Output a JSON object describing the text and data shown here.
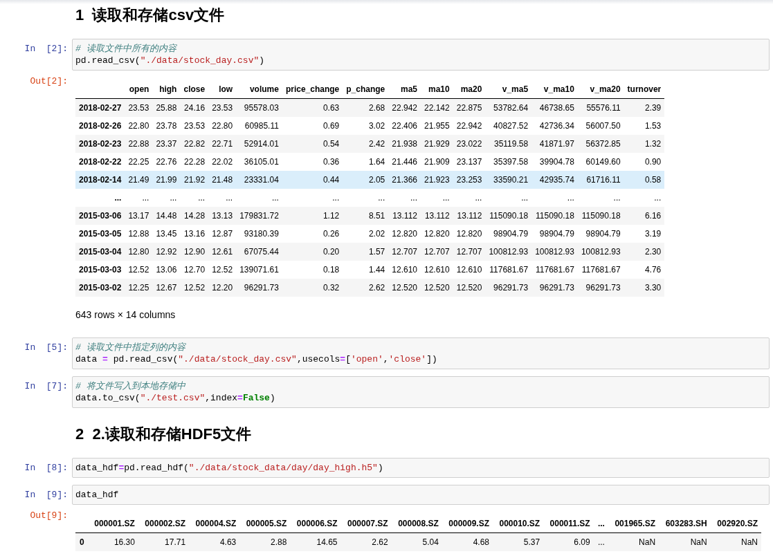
{
  "cells": [
    {
      "kind": "heading",
      "text": "1  读取和存储csv文件"
    },
    {
      "kind": "code",
      "prompt": "In  [2]:",
      "lines": [
        [
          {
            "kind": "comment",
            "text": "# 读取文件中所有的内容"
          }
        ],
        [
          {
            "kind": "plain",
            "text": "pd.read_csv("
          },
          {
            "kind": "string",
            "text": "\"./data/stock_day.csv\""
          },
          {
            "kind": "plain",
            "text": ")"
          }
        ]
      ]
    },
    {
      "kind": "output",
      "prompt": "Out[2]:",
      "table": {
        "columns": [
          "",
          "open",
          "high",
          "close",
          "low",
          "volume",
          "price_change",
          "p_change",
          "ma5",
          "ma10",
          "ma20",
          "v_ma5",
          "v_ma10",
          "v_ma20",
          "turnover"
        ],
        "rows": [
          {
            "selected": false,
            "cells": [
              "2018-02-27",
              "23.53",
              "25.88",
              "24.16",
              "23.53",
              "95578.03",
              "0.63",
              "2.68",
              "22.942",
              "22.142",
              "22.875",
              "53782.64",
              "46738.65",
              "55576.11",
              "2.39"
            ]
          },
          {
            "selected": false,
            "cells": [
              "2018-02-26",
              "22.80",
              "23.78",
              "23.53",
              "22.80",
              "60985.11",
              "0.69",
              "3.02",
              "22.406",
              "21.955",
              "22.942",
              "40827.52",
              "42736.34",
              "56007.50",
              "1.53"
            ]
          },
          {
            "selected": false,
            "cells": [
              "2018-02-23",
              "22.88",
              "23.37",
              "22.82",
              "22.71",
              "52914.01",
              "0.54",
              "2.42",
              "21.938",
              "21.929",
              "23.022",
              "35119.58",
              "41871.97",
              "56372.85",
              "1.32"
            ]
          },
          {
            "selected": false,
            "cells": [
              "2018-02-22",
              "22.25",
              "22.76",
              "22.28",
              "22.02",
              "36105.01",
              "0.36",
              "1.64",
              "21.446",
              "21.909",
              "23.137",
              "35397.58",
              "39904.78",
              "60149.60",
              "0.90"
            ]
          },
          {
            "selected": true,
            "cells": [
              "2018-02-14",
              "21.49",
              "21.99",
              "21.92",
              "21.48",
              "23331.04",
              "0.44",
              "2.05",
              "21.366",
              "21.923",
              "23.253",
              "33590.21",
              "42935.74",
              "61716.11",
              "0.58"
            ]
          },
          {
            "selected": false,
            "cells": [
              "...",
              "...",
              "...",
              "...",
              "...",
              "...",
              "...",
              "...",
              "...",
              "...",
              "...",
              "...",
              "...",
              "...",
              "..."
            ]
          },
          {
            "selected": false,
            "cells": [
              "2015-03-06",
              "13.17",
              "14.48",
              "14.28",
              "13.13",
              "179831.72",
              "1.12",
              "8.51",
              "13.112",
              "13.112",
              "13.112",
              "115090.18",
              "115090.18",
              "115090.18",
              "6.16"
            ]
          },
          {
            "selected": false,
            "cells": [
              "2015-03-05",
              "12.88",
              "13.45",
              "13.16",
              "12.87",
              "93180.39",
              "0.26",
              "2.02",
              "12.820",
              "12.820",
              "12.820",
              "98904.79",
              "98904.79",
              "98904.79",
              "3.19"
            ]
          },
          {
            "selected": false,
            "cells": [
              "2015-03-04",
              "12.80",
              "12.92",
              "12.90",
              "12.61",
              "67075.44",
              "0.20",
              "1.57",
              "12.707",
              "12.707",
              "12.707",
              "100812.93",
              "100812.93",
              "100812.93",
              "2.30"
            ]
          },
          {
            "selected": false,
            "cells": [
              "2015-03-03",
              "12.52",
              "13.06",
              "12.70",
              "12.52",
              "139071.61",
              "0.18",
              "1.44",
              "12.610",
              "12.610",
              "12.610",
              "117681.67",
              "117681.67",
              "117681.67",
              "4.76"
            ]
          },
          {
            "selected": false,
            "cells": [
              "2015-03-02",
              "12.25",
              "12.67",
              "12.52",
              "12.20",
              "96291.73",
              "0.32",
              "2.62",
              "12.520",
              "12.520",
              "12.520",
              "96291.73",
              "96291.73",
              "96291.73",
              "3.30"
            ]
          }
        ],
        "shape": "643 rows × 14 columns"
      }
    },
    {
      "kind": "code",
      "prompt": "In  [5]:",
      "lines": [
        [
          {
            "kind": "comment",
            "text": "# 读取文件中指定列的内容"
          }
        ],
        [
          {
            "kind": "plain",
            "text": "data "
          },
          {
            "kind": "operator",
            "text": "="
          },
          {
            "kind": "plain",
            "text": " pd.read_csv("
          },
          {
            "kind": "string",
            "text": "\"./data/stock_day.csv\""
          },
          {
            "kind": "plain",
            "text": ",usecols"
          },
          {
            "kind": "operator",
            "text": "="
          },
          {
            "kind": "plain",
            "text": "["
          },
          {
            "kind": "string",
            "text": "'open'"
          },
          {
            "kind": "plain",
            "text": ","
          },
          {
            "kind": "string",
            "text": "'close'"
          },
          {
            "kind": "plain",
            "text": "])"
          }
        ]
      ]
    },
    {
      "kind": "code",
      "prompt": "In  [7]:",
      "lines": [
        [
          {
            "kind": "comment",
            "text": "# 将文件写入到本地存储中"
          }
        ],
        [
          {
            "kind": "plain",
            "text": "data.to_csv("
          },
          {
            "kind": "string",
            "text": "\"./test.csv\""
          },
          {
            "kind": "plain",
            "text": ",index"
          },
          {
            "kind": "operator",
            "text": "="
          },
          {
            "kind": "keyword",
            "text": "False"
          },
          {
            "kind": "plain",
            "text": ")"
          }
        ]
      ]
    },
    {
      "kind": "heading",
      "text": "2  2.读取和存储HDF5文件"
    },
    {
      "kind": "code",
      "prompt": "In  [8]:",
      "lines": [
        [
          {
            "kind": "plain",
            "text": "data_hdf"
          },
          {
            "kind": "operator",
            "text": "="
          },
          {
            "kind": "plain",
            "text": "pd.read_hdf("
          },
          {
            "kind": "string",
            "text": "\"./data/stock_data/day/day_high.h5\""
          },
          {
            "kind": "plain",
            "text": ")"
          }
        ]
      ]
    },
    {
      "kind": "code",
      "prompt": "In  [9]:",
      "lines": [
        [
          {
            "kind": "plain",
            "text": "data_hdf"
          }
        ]
      ]
    },
    {
      "kind": "output",
      "prompt": "Out[9]:",
      "table": {
        "columns": [
          "",
          "000001.SZ",
          "000002.SZ",
          "000004.SZ",
          "000005.SZ",
          "000006.SZ",
          "000007.SZ",
          "000008.SZ",
          "000009.SZ",
          "000010.SZ",
          "000011.SZ",
          "...",
          "001965.SZ",
          "603283.SH",
          "002920.SZ"
        ],
        "rows": [
          {
            "selected": false,
            "cells": [
              "0",
              "16.30",
              "17.71",
              "4.63",
              "2.88",
              "14.65",
              "2.62",
              "5.04",
              "4.68",
              "5.37",
              "6.09",
              "...",
              "NaN",
              "NaN",
              "NaN"
            ]
          }
        ]
      }
    }
  ]
}
